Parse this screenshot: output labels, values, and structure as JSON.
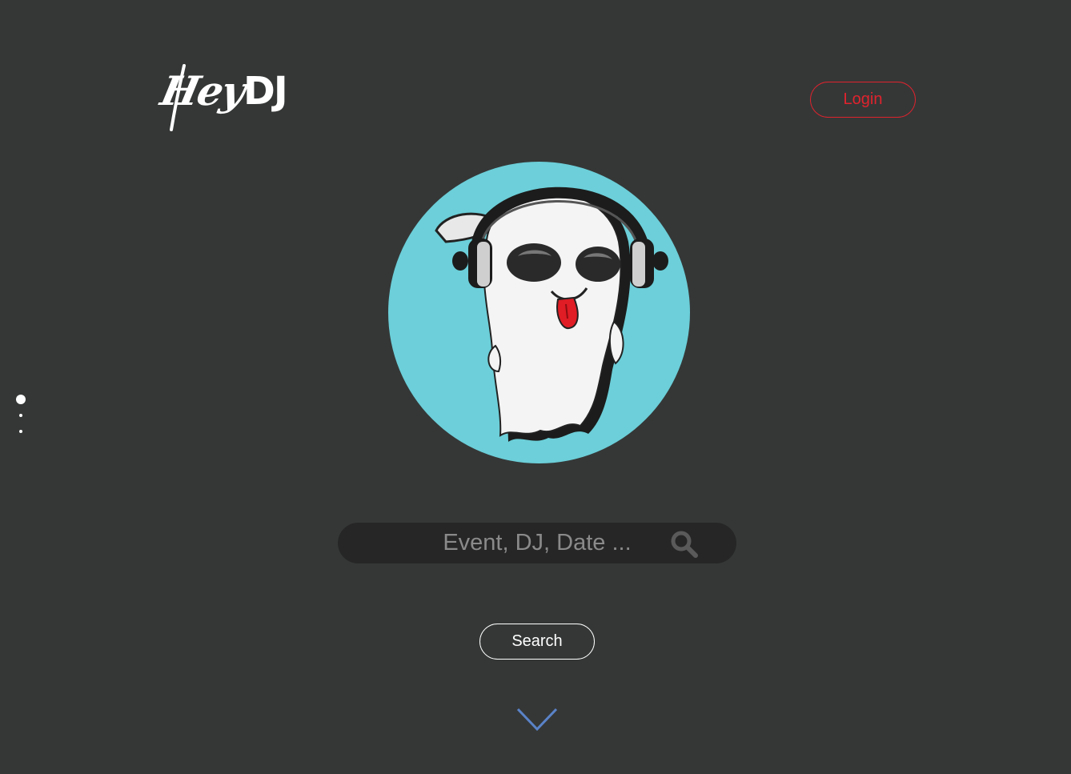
{
  "header": {
    "logo_text_script": "Hey",
    "logo_text_bold": "DJ",
    "login_label": "Login"
  },
  "hero": {
    "mascot_icon": "ghost-dj-headphones-icon"
  },
  "search": {
    "placeholder": "Event, DJ, Date ...",
    "icon": "search-icon",
    "button_label": "Search"
  },
  "pagination": {
    "count": 3,
    "active_index": 0
  },
  "scroll_down_icon": "chevron-down-icon",
  "colors": {
    "background": "#353737",
    "accent_red": "#e0232d",
    "mascot_circle": "#6ccfd9",
    "chevron": "#5a83c8",
    "search_bg": "#262626"
  }
}
